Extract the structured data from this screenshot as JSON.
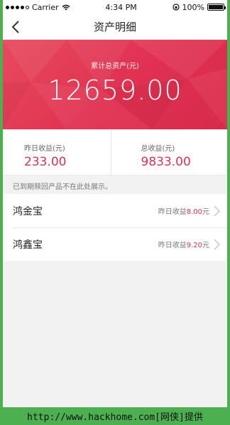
{
  "status_bar": {
    "carrier": "Carrier",
    "time": "4:34 PM",
    "battery": "100%"
  },
  "nav": {
    "title": "资产明细"
  },
  "hero": {
    "label": "累计总资产(元)",
    "value": "12659.00"
  },
  "earnings": [
    {
      "label": "昨日收益(元)",
      "value": "233.00"
    },
    {
      "label": "总收益(元)",
      "value": "9833.00"
    }
  ],
  "notice": "已到期赎回产品不在此处展示。",
  "products": [
    {
      "name": "鸿金宝",
      "yesterday_label": "昨日收益",
      "amount": "8.00",
      "unit": "元"
    },
    {
      "name": "鸿鑫宝",
      "yesterday_label": "昨日收益",
      "amount": "9.20",
      "unit": "元"
    }
  ],
  "footer": {
    "text": "http://www.hackhome.com[网侠]提供"
  },
  "colors": {
    "accent": "#e03151",
    "frame": "#4caf50"
  }
}
